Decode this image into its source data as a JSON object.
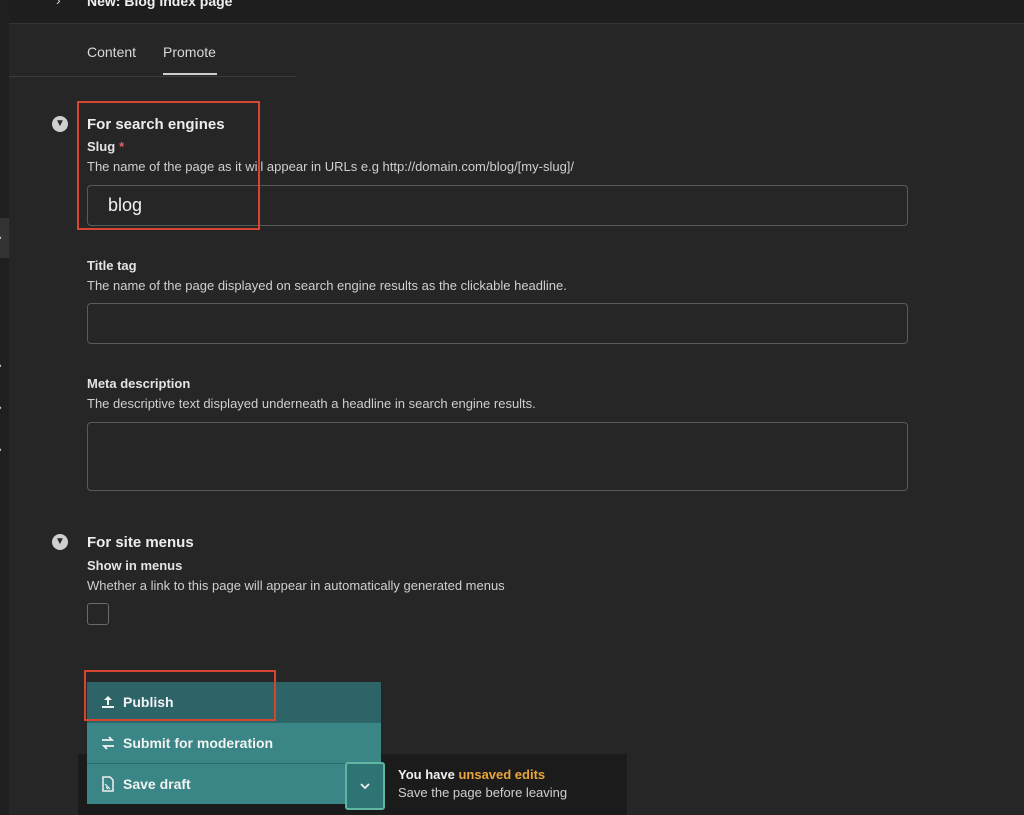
{
  "header": {
    "breadcrumb": "New: Blog index page"
  },
  "tabs": [
    {
      "label": "Content"
    },
    {
      "label": "Promote"
    }
  ],
  "sections": {
    "search": {
      "title": "For search engines",
      "slug": {
        "label": "Slug",
        "required": "*",
        "help": "The name of the page as it will appear in URLs e.g http://domain.com/blog/[my-slug]/",
        "value": "blog"
      },
      "title_tag": {
        "label": "Title tag",
        "help": "The name of the page displayed on search engine results as the clickable headline.",
        "value": ""
      },
      "meta": {
        "label": "Meta description",
        "help": "The descriptive text displayed underneath a headline in search engine results.",
        "value": ""
      }
    },
    "menus": {
      "title": "For site menus",
      "show": {
        "label": "Show in menus",
        "help": "Whether a link to this page will appear in automatically generated menus"
      }
    }
  },
  "actions": {
    "publish": "Publish",
    "submit": "Submit for moderation",
    "save": "Save draft"
  },
  "status": {
    "prefix": "You have ",
    "highlight": "unsaved edits",
    "sub": "Save the page before leaving"
  },
  "colors": {
    "accent": "#3a8585",
    "highlight_box": "#d6452f",
    "unsaved": "#e9a53a"
  }
}
